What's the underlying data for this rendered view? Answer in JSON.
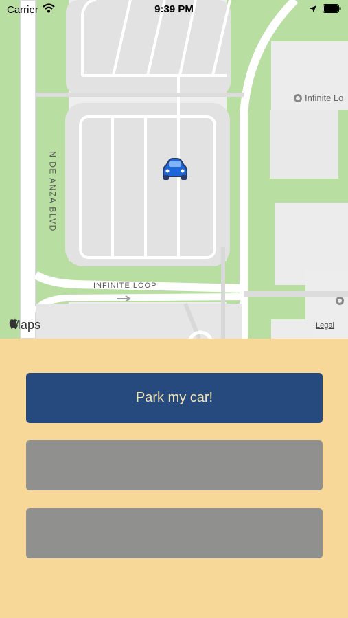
{
  "status_bar": {
    "carrier": "Carrier",
    "time": "9:39 PM"
  },
  "map": {
    "road_vertical": "N DE ANZA BLVD",
    "road_horizontal": "INFINITE LOOP",
    "poi_label": "Infinite Lo",
    "maps_attribution": "Maps",
    "legal_label": "Legal",
    "marker_icon": "car-icon",
    "marker_color": "#1d66d9"
  },
  "actions": {
    "primary_label": "Park my car!",
    "second_label": "",
    "third_label": ""
  },
  "colors": {
    "panel_bg": "#f7d898",
    "primary_btn": "#274a7e",
    "disabled_btn": "#90918e"
  }
}
